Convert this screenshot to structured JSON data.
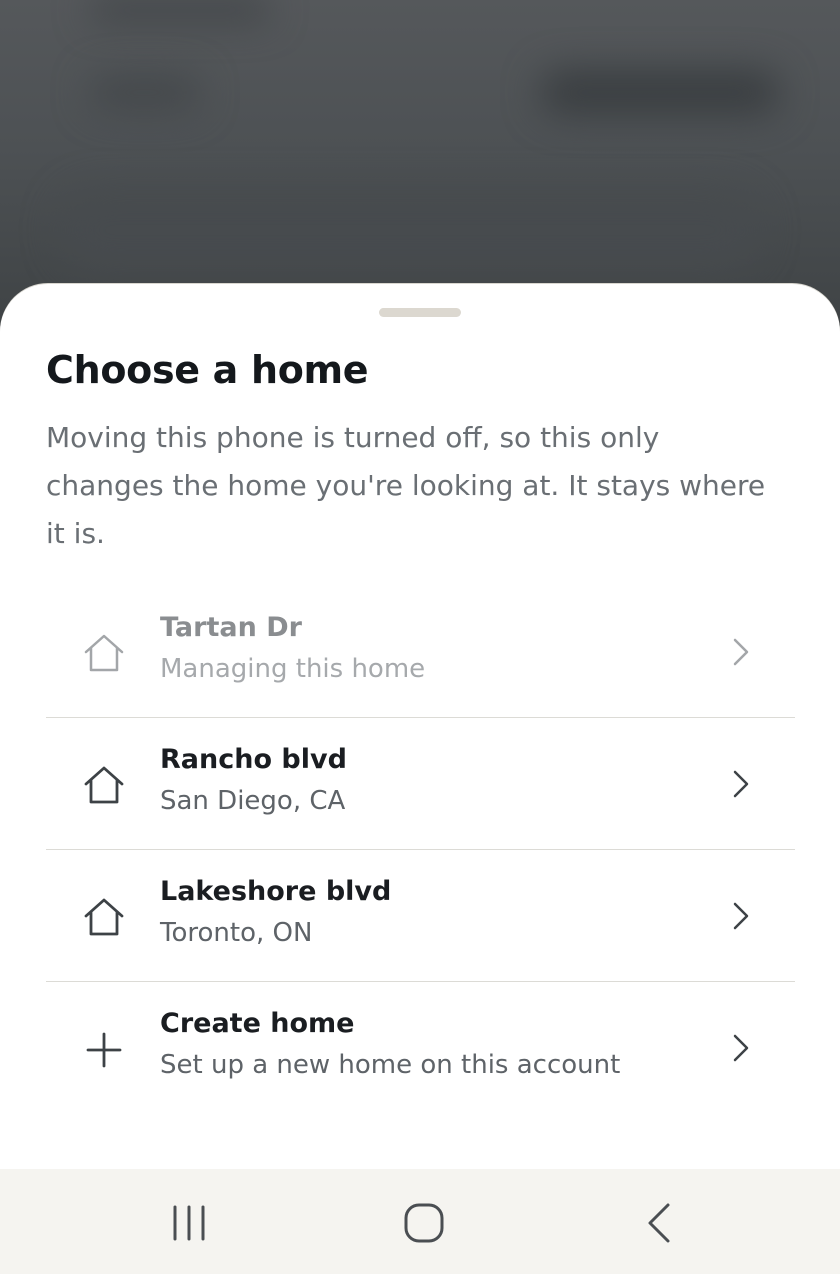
{
  "sheet": {
    "title": "Choose a home",
    "subtitle": "Moving this phone is turned off, so this only changes the home you're looking at. It stays where it is."
  },
  "homes": [
    {
      "name": "Tartan Dr",
      "detail": "Managing this home",
      "icon": "house-icon",
      "state": "current"
    },
    {
      "name": "Rancho blvd",
      "detail": "San Diego, CA",
      "icon": "house-icon",
      "state": "selectable"
    },
    {
      "name": "Lakeshore blvd",
      "detail": "Toronto, ON",
      "icon": "house-icon",
      "state": "selectable"
    }
  ],
  "create": {
    "name": "Create home",
    "detail": "Set up a new home on this account",
    "icon": "plus-icon"
  },
  "navbar": {
    "icons": [
      "recent-apps-icon",
      "home-icon",
      "back-icon"
    ]
  },
  "colors": {
    "sheet_bg": "#ffffff",
    "scrim": "#4b4f52",
    "title": "#14181c",
    "muted_text": "#6a6f74",
    "divider": "#dcdbd6",
    "navbar_bg": "#f5f4f0"
  }
}
